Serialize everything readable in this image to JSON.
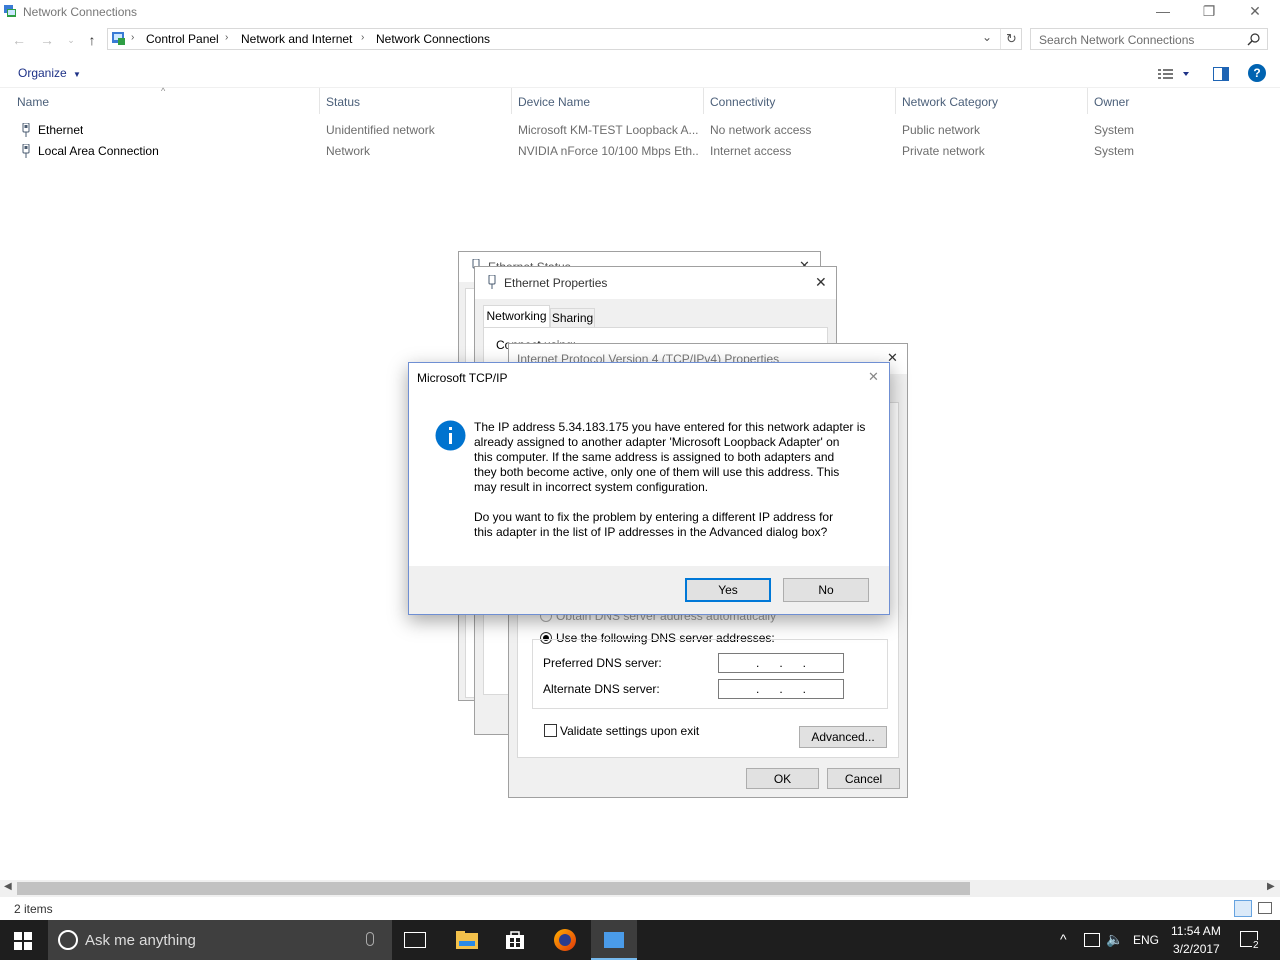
{
  "window": {
    "title": "Network Connections",
    "controls": {
      "minimize": "—",
      "restore": "❐",
      "close": "✕"
    }
  },
  "nav": {
    "breadcrumbs": [
      "Control Panel",
      "Network and Internet",
      "Network Connections"
    ],
    "search_placeholder": "Search Network Connections"
  },
  "command_bar": {
    "organize": "Organize"
  },
  "columns": [
    "Name",
    "Status",
    "Device Name",
    "Connectivity",
    "Network Category",
    "Owner"
  ],
  "rows": [
    {
      "name": "Ethernet",
      "status": "Unidentified network",
      "device": "Microsoft KM-TEST Loopback A...",
      "connectivity": "No network access",
      "category": "Public network",
      "owner": "System"
    },
    {
      "name": "Local Area Connection",
      "status": "Network",
      "device": "NVIDIA nForce 10/100 Mbps Eth...",
      "connectivity": "Internet access",
      "category": "Private network",
      "owner": "System"
    }
  ],
  "status_bar": {
    "items": "2 items"
  },
  "ethernet_status": {
    "title": "Ethernet Status"
  },
  "ethernet_properties": {
    "title": "Ethernet Properties",
    "tabs": [
      "Networking",
      "Sharing"
    ],
    "connect_using": "Connect using:"
  },
  "ipv4": {
    "title": "Internet Protocol Version 4 (TCP/IPv4) Properties",
    "obtain_dns": "Obtain DNS server address automatically",
    "use_dns": "Use the following DNS server addresses:",
    "preferred_dns": "Preferred DNS server:",
    "alternate_dns": "Alternate DNS server:",
    "ip_dots": ".      .      .",
    "validate": "Validate settings upon exit",
    "advanced": "Advanced...",
    "ok": "OK",
    "cancel": "Cancel"
  },
  "message_box": {
    "title": "Microsoft TCP/IP",
    "lines1": [
      "The IP address 5.34.183.175 you have entered for this network adapter is",
      "already assigned to another adapter 'Microsoft Loopback Adapter' on",
      "this computer. If the same address is assigned to both adapters and",
      "they both become active, only one of them will use this address.  This",
      "may result in incorrect system configuration."
    ],
    "lines2": [
      "Do you want to fix the problem by entering a different IP address for",
      "this adapter in the list of IP addresses in the Advanced dialog box?"
    ],
    "yes": "Yes",
    "no": "No",
    "icon": "information-icon"
  },
  "taskbar": {
    "search_placeholder": "Ask me anything",
    "language": "ENG",
    "time": "11:54 AM",
    "date": "3/2/2017",
    "notification_count": "2"
  },
  "colors": {
    "accent": "#0078d7",
    "link": "#1e3287",
    "taskbar": "#1e1e1e"
  }
}
